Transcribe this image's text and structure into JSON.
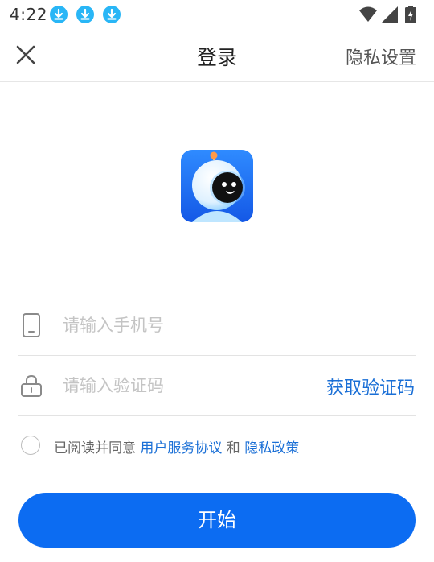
{
  "status_bar": {
    "time": "4:22",
    "notification_icons": [
      "download-icon",
      "download-icon",
      "download-icon"
    ],
    "right_icons": [
      "wifi-icon",
      "cellular-signal-icon",
      "battery-charging-icon"
    ]
  },
  "nav": {
    "close_icon": "close-icon",
    "title": "登录",
    "privacy_settings": "隐私设置"
  },
  "logo": {
    "icon": "astronaut-app-logo",
    "color": "#1e6ff2"
  },
  "form": {
    "phone": {
      "icon": "phone-icon",
      "placeholder": "请输入手机号",
      "value": ""
    },
    "code": {
      "icon": "lock-icon",
      "placeholder": "请输入验证码",
      "value": "",
      "get_code_label": "获取验证码"
    }
  },
  "agreement": {
    "checked": false,
    "prefix": "已阅读并同意 ",
    "user_agreement": "用户服务协议",
    "conjunction": " 和 ",
    "privacy_policy": "隐私政策"
  },
  "start_button": {
    "label": "开始",
    "color": "#0c6cf2"
  },
  "colors": {
    "accent": "#1a6fd6",
    "primary_button": "#0c6cf2",
    "download_badge": "#29b6f6"
  }
}
